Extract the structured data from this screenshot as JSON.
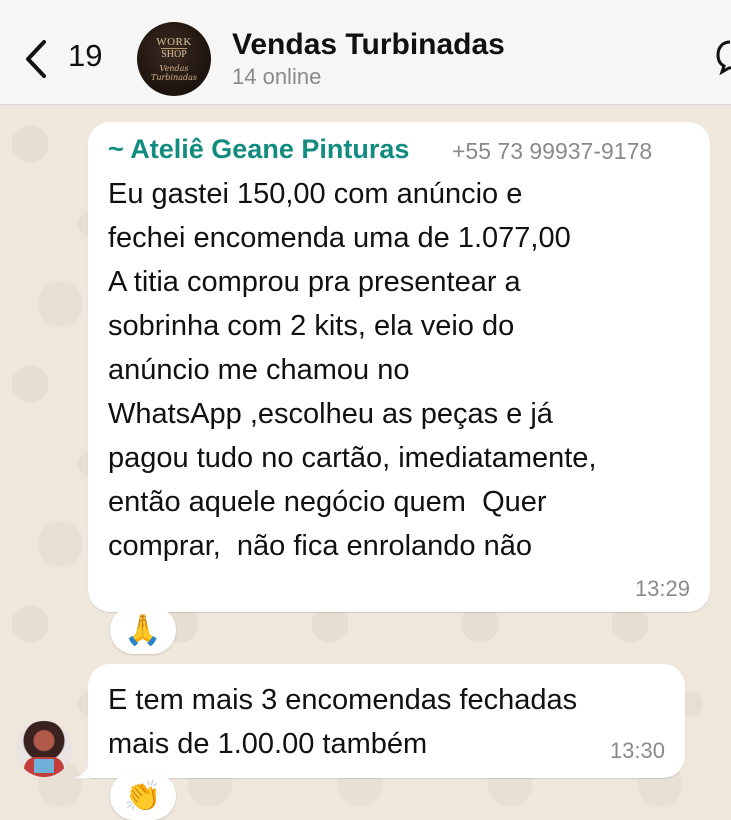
{
  "header": {
    "back_count": "19",
    "avatar": {
      "line1": "WORK",
      "line2": "SHOP",
      "line3": "Vendas Turbinadas"
    },
    "group_name": "Vendas Turbinadas",
    "status": "14 online"
  },
  "messages": [
    {
      "sender": "~ Ateliê Geane Pinturas",
      "phone": "+55 73 99937-9178",
      "text": "Eu gastei 150,00 com anúncio e\nfechei encomenda uma de 1.077,00\nA titia comprou pra presentear a\nsobrinha com 2 kits, ela veio do\nanúncio me chamou no\nWhatsApp ,escolheu as peças e já\npagou tudo no cartão, imediatamente,\nentão aquele negócio quem  Quer\ncomprar,  não fica enrolando não",
      "time": "13:29",
      "reaction": "🙏"
    },
    {
      "text": "E tem mais 3 encomendas fechadas\nmais de 1.00.00 também",
      "time": "13:30",
      "reaction": "👏"
    }
  ]
}
